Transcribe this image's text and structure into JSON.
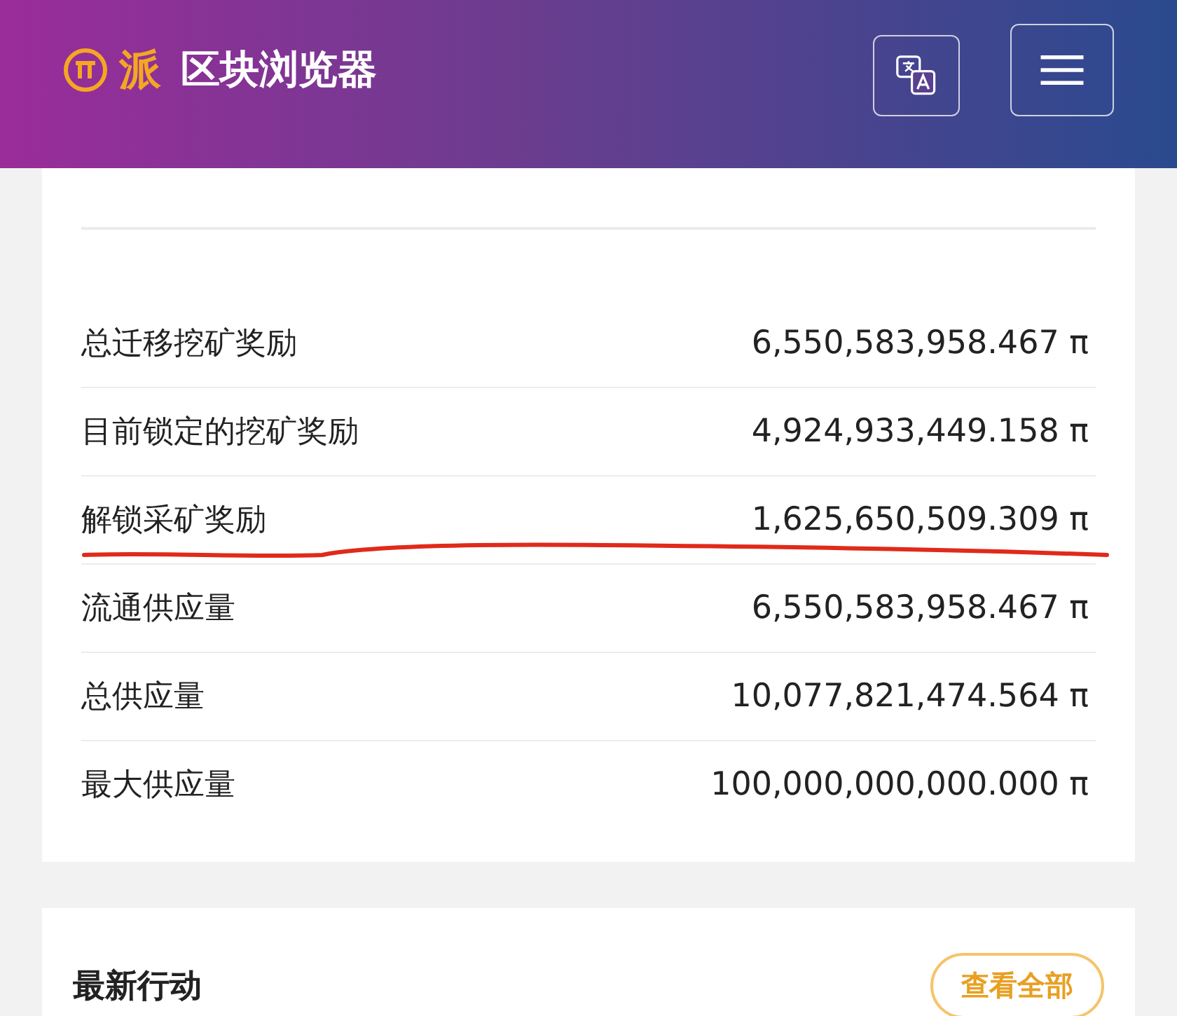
{
  "header": {
    "logo_mark": "派",
    "title": "区块浏览器"
  },
  "supply": {
    "rows": [
      {
        "label": "总迁移挖矿奖励",
        "value": "6,550,583,958.467 π",
        "underlined": false
      },
      {
        "label": "目前锁定的挖矿奖励",
        "value": "4,924,933,449.158 π",
        "underlined": false
      },
      {
        "label": "解锁采矿奖励",
        "value": "1,625,650,509.309 π",
        "underlined": true
      },
      {
        "label": "流通供应量",
        "value": "6,550,583,958.467 π",
        "underlined": false
      },
      {
        "label": "总供应量",
        "value": "10,077,821,474.564 π",
        "underlined": false
      },
      {
        "label": "最大供应量",
        "value": "100,000,000,000.000 π",
        "underlined": false
      }
    ]
  },
  "latest": {
    "title": "最新行动",
    "button": "查看全部"
  }
}
